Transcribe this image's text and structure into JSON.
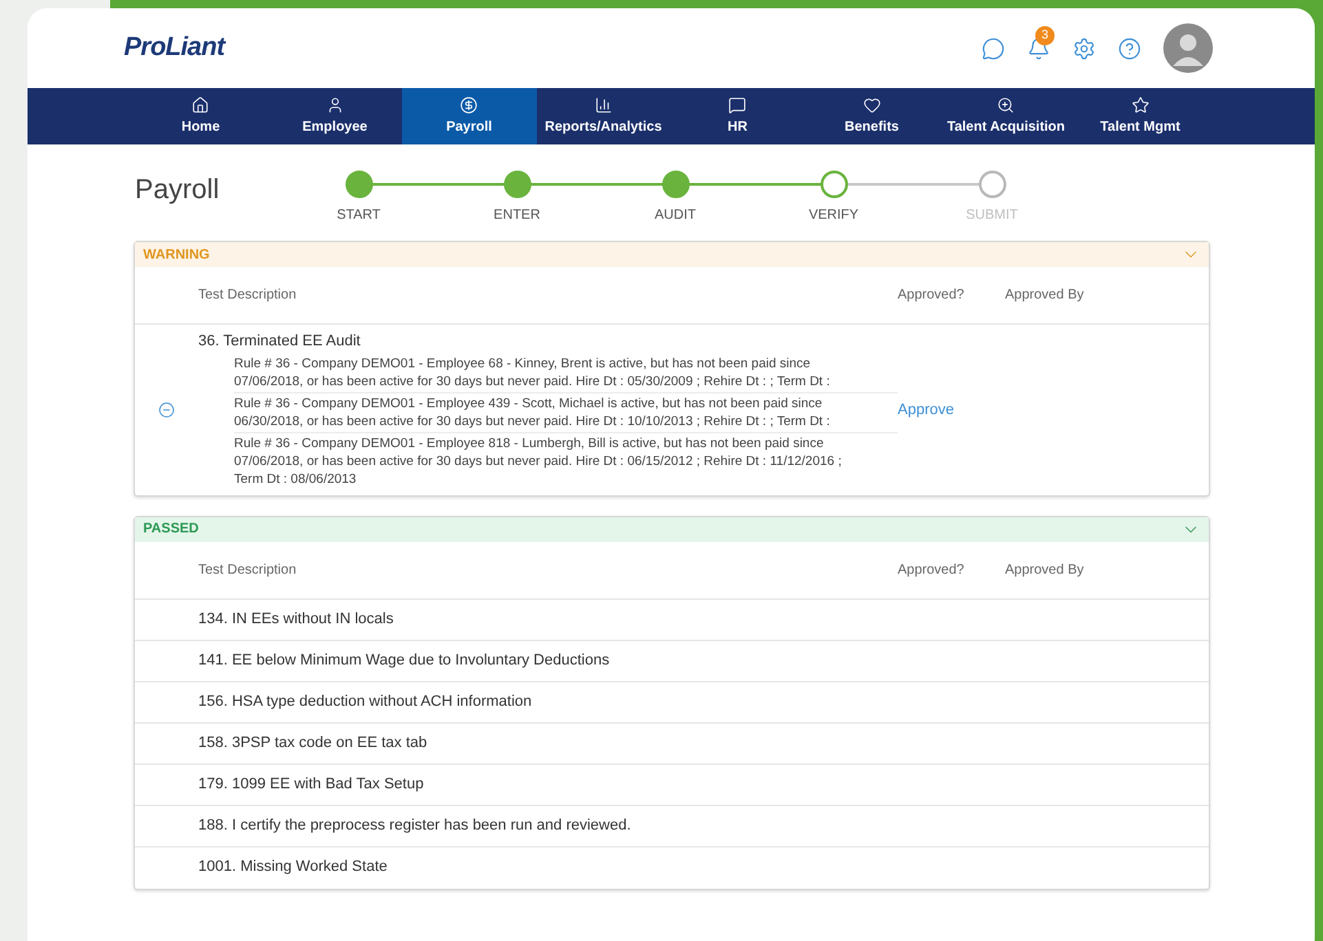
{
  "header": {
    "logo": "ProLiant",
    "notifications": {
      "count": "3"
    }
  },
  "nav": [
    {
      "label": "Home",
      "selected": false
    },
    {
      "label": "Employee",
      "selected": false
    },
    {
      "label": "Payroll",
      "selected": true
    },
    {
      "label": "Reports/Analytics",
      "selected": false
    },
    {
      "label": "HR",
      "selected": false
    },
    {
      "label": "Benefits",
      "selected": false
    },
    {
      "label": "Talent Acquisition",
      "selected": false
    },
    {
      "label": "Talent Mgmt",
      "selected": false
    }
  ],
  "page_title": "Payroll",
  "steps": [
    {
      "label": "START",
      "kind": "done"
    },
    {
      "label": "ENTER",
      "kind": "done"
    },
    {
      "label": "AUDIT",
      "kind": "done"
    },
    {
      "label": "VERIFY",
      "kind": "current"
    },
    {
      "label": "SUBMIT",
      "kind": "pending"
    }
  ],
  "sections": [
    {
      "kind": "warning",
      "title": "WARNING",
      "expanded": true,
      "columns": [
        "Test Description",
        "Approved?",
        "Approved By"
      ],
      "rows": [
        {
          "title": "36. Terminated EE Audit",
          "details": [
            "Rule # 36 - Company DEMO01 - Employee 68 - Kinney, Brent is active, but has not been paid since 07/06/2018, or has been active for 30 days but never paid. Hire Dt : 05/30/2009 ; Rehire Dt : ; Term Dt :",
            "Rule # 36 - Company DEMO01 - Employee 439 - Scott, Michael is active, but has not been paid since 06/30/2018, or has been active for 30 days but never paid. Hire Dt : 10/10/2013 ; Rehire Dt : ; Term Dt :",
            "Rule # 36 - Company DEMO01 - Employee 818 - Lumbergh, Bill is active, but has not been paid since 07/06/2018, or has been active for 30 days but never paid. Hire Dt : 06/15/2012 ; Rehire Dt : 11/12/2016 ; Term Dt : 08/06/2013"
          ],
          "action": "Approve"
        }
      ]
    },
    {
      "kind": "passed",
      "title": "PASSED",
      "expanded": true,
      "columns": [
        "Test Description",
        "Approved?",
        "Approved By"
      ],
      "rows": [
        {
          "title": "134. IN EEs without IN locals"
        },
        {
          "title": "141. EE below Minimum Wage due to Involuntary Deductions"
        },
        {
          "title": "156. HSA type deduction without ACH information"
        },
        {
          "title": "158. 3PSP tax code on EE tax tab"
        },
        {
          "title": "179. 1099 EE with Bad Tax Setup"
        },
        {
          "title": "188. I certify the preprocess register has been run and reviewed."
        },
        {
          "title": "1001. Missing Worked State"
        }
      ]
    }
  ]
}
